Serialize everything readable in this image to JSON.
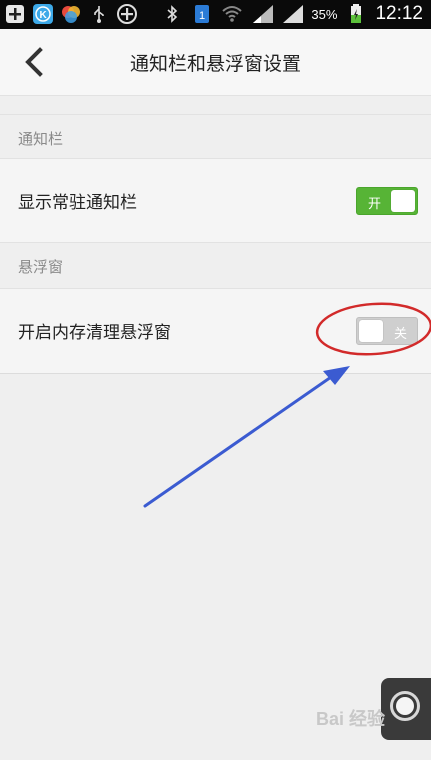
{
  "status_bar": {
    "battery": "35%",
    "time": "12:12",
    "icons": [
      "add-icon",
      "k-app-icon",
      "color-app-icon",
      "usb-icon",
      "plus-circle-icon",
      "bluetooth-icon",
      "sim-icon",
      "wifi-icon",
      "signal-icon",
      "signal-icon",
      "battery-charging-icon"
    ]
  },
  "header": {
    "title": "通知栏和悬浮窗设置"
  },
  "sections": [
    {
      "title": "通知栏",
      "row_label": "显示常驻通知栏",
      "toggle_text": "开",
      "enabled": true
    },
    {
      "title": "悬浮窗",
      "row_label": "开启内存清理悬浮窗",
      "toggle_text": "关",
      "enabled": false
    }
  ],
  "watermark": "Bai 经验",
  "colors": {
    "toggle_on": "#57b436",
    "toggle_off": "#cfcfcf",
    "annotation_circle": "#d22a2a",
    "annotation_arrow": "#3b5bd1"
  }
}
